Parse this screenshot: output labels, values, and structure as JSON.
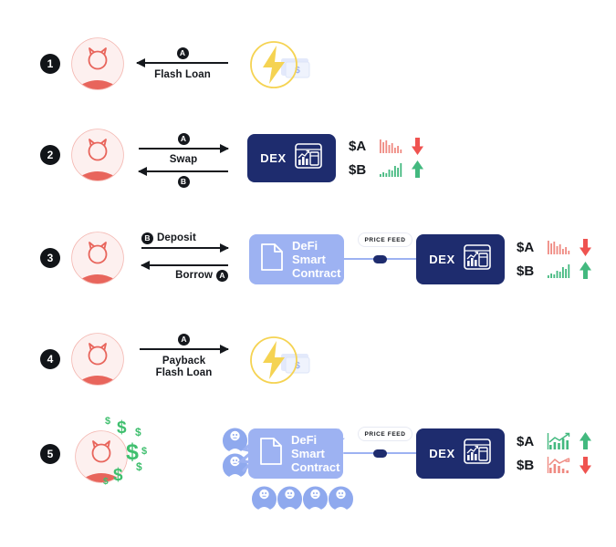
{
  "diagram": {
    "title": "Flash Loan Price Oracle Attack Flow",
    "colors": {
      "accent_navy": "#1e2c6e",
      "accent_periwinkle": "#9db2f2",
      "hacker_red": "#e8655c",
      "flash_yellow": "#f5d352",
      "money_green": "#3fbf6e",
      "down_red": "#ef5350",
      "up_green": "#43b97f",
      "badge_black": "#15181d"
    },
    "labels": {
      "dex": "DEX",
      "defi_contract": "DeFi\nSmart\nContract",
      "defi_line1": "DeFi",
      "defi_line2": "Smart",
      "defi_line3": "Contract",
      "price_feed": "PRICE FEED",
      "token_a": "$A",
      "token_b": "$B",
      "money_symbol": "$"
    }
  },
  "steps": [
    {
      "number": "1",
      "actor": "hacker-avatar",
      "flows": [
        {
          "badge": "A",
          "label": "Flash Loan",
          "direction": "left",
          "label_position": "below",
          "badge_position": "above"
        }
      ],
      "nodes": [
        "flash-loan-icon"
      ]
    },
    {
      "number": "2",
      "actor": "hacker-avatar",
      "flows": [
        {
          "badge": "A",
          "label": "",
          "direction": "right",
          "badge_position": "above"
        },
        {
          "badge": "B",
          "label": "Swap",
          "direction": "left",
          "badge_position": "below"
        }
      ],
      "nodes": [
        "dex-block"
      ],
      "tokens": [
        {
          "name": "$A",
          "trend": "down",
          "spark": "down"
        },
        {
          "name": "$B",
          "trend": "up",
          "spark": "up"
        }
      ]
    },
    {
      "number": "3",
      "actor": "hacker-avatar",
      "flows": [
        {
          "badge": "B",
          "label": "Deposit",
          "direction": "right",
          "badge_side": "left"
        },
        {
          "badge": "A",
          "label": "Borrow",
          "direction": "left",
          "badge_side": "right"
        }
      ],
      "nodes": [
        "defi-smart-contract",
        "price-feed",
        "dex-block"
      ],
      "tokens": [
        {
          "name": "$A",
          "trend": "down",
          "spark": "down"
        },
        {
          "name": "$B",
          "trend": "up",
          "spark": "up"
        }
      ]
    },
    {
      "number": "4",
      "actor": "hacker-avatar",
      "flows": [
        {
          "badge": "A",
          "label": "Payback\nFlash Loan",
          "line1": "Payback",
          "line2": "Flash Loan",
          "direction": "right",
          "badge_position": "above"
        }
      ],
      "nodes": [
        "flash-loan-icon"
      ]
    },
    {
      "number": "5",
      "actor": "hacker-avatar-with-money",
      "flows": [],
      "nodes": [
        "defi-smart-contract-broken",
        "price-feed",
        "dex-block",
        "victim-crowd"
      ],
      "tokens": [
        {
          "name": "$A",
          "trend": "up",
          "spark": "up"
        },
        {
          "name": "$B",
          "trend": "down",
          "spark": "down"
        }
      ]
    }
  ],
  "step_numbers": {
    "s1": "1",
    "s2": "2",
    "s3": "3",
    "s4": "4",
    "s5": "5"
  },
  "flow_text": {
    "r1_badge": "A",
    "r1_label": "Flash Loan",
    "r2_badge_top": "A",
    "r2_label": "Swap",
    "r2_badge_bottom": "B",
    "r3_badge_deposit": "B",
    "r3_label_deposit": "Deposit",
    "r3_label_borrow": "Borrow",
    "r3_badge_borrow": "A",
    "r4_badge": "A",
    "r4_label_line1": "Payback",
    "r4_label_line2": "Flash Loan"
  }
}
